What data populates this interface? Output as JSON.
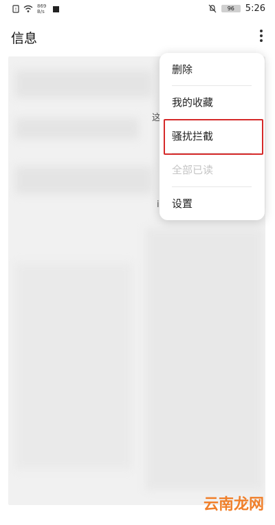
{
  "status_bar": {
    "net_speed_value": "869",
    "net_speed_unit": "B/s",
    "battery": "96",
    "time": "5:26",
    "icons": [
      "sim-icon",
      "wifi-icon",
      "stop-icon",
      "mute-bell-icon",
      "battery-icon"
    ]
  },
  "app_bar": {
    "title": "信息"
  },
  "menu": {
    "items": [
      {
        "label": "删除",
        "enabled": true
      },
      {
        "label": "我的收藏",
        "enabled": true
      },
      {
        "label": "骚扰拦截",
        "enabled": true,
        "highlighted": true
      },
      {
        "label": "全部已读",
        "enabled": false
      },
      {
        "label": "设置",
        "enabled": true
      }
    ]
  },
  "content_peek": {
    "text_1": "这",
    "text_2": "i"
  },
  "annotation": {
    "highlight_color": "#d52828"
  },
  "watermark": "云南龙网"
}
